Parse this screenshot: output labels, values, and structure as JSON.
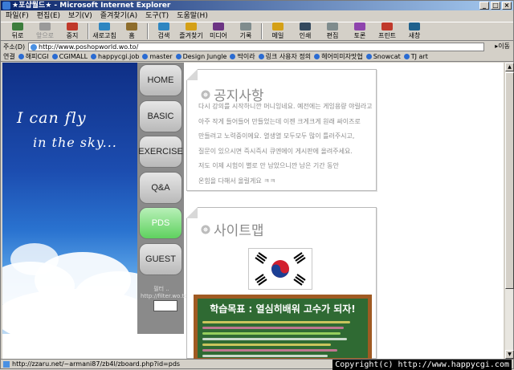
{
  "window": {
    "title": "★포샵월드★ - Microsoft Internet Explorer",
    "buttons": [
      "_",
      "□",
      "×"
    ]
  },
  "menubar": [
    "파일(F)",
    "편집(E)",
    "보기(V)",
    "즐겨찾기(A)",
    "도구(T)",
    "도움말(H)"
  ],
  "toolbar": [
    {
      "label": "뒤로",
      "icon": "back-arrow-icon",
      "disabled": false
    },
    {
      "label": "앞으로",
      "icon": "forward-arrow-icon",
      "disabled": true
    },
    {
      "label": "중지",
      "icon": "stop-icon",
      "disabled": false
    },
    {
      "label": "새로고침",
      "icon": "refresh-icon",
      "disabled": false
    },
    {
      "label": "홈",
      "icon": "home-icon",
      "disabled": false
    },
    {
      "label": "검색",
      "icon": "search-icon",
      "disabled": false
    },
    {
      "label": "즐겨찾기",
      "icon": "favorites-icon",
      "disabled": false
    },
    {
      "label": "미디어",
      "icon": "media-icon",
      "disabled": false
    },
    {
      "label": "기록",
      "icon": "history-icon",
      "disabled": false
    },
    {
      "label": "메일",
      "icon": "mail-icon",
      "disabled": false
    },
    {
      "label": "인쇄",
      "icon": "print-icon",
      "disabled": false
    },
    {
      "label": "편집",
      "icon": "edit-icon",
      "disabled": false
    },
    {
      "label": "토론",
      "icon": "discuss-icon",
      "disabled": false
    },
    {
      "label": "프린트",
      "icon": "printer-icon",
      "disabled": false
    },
    {
      "label": "새창",
      "icon": "new-window-icon",
      "disabled": false
    }
  ],
  "address": {
    "label": "주소(D)",
    "value": "http://www.poshopworld.wo.to/",
    "go": "이동"
  },
  "links": {
    "label": "연결",
    "items": [
      "해피CGI",
      "CGIMALL",
      "happycgi.job",
      "master",
      "Design Jungle",
      "딱이라",
      "링크 사용자 정의",
      "헤어미미자맛협",
      "Snowcat",
      "TJ art"
    ]
  },
  "hero": {
    "line1": "I can fly",
    "line2": "in the sky..."
  },
  "nav": [
    "HOME",
    "BASIC",
    "EXERCISE",
    "Q&A",
    "PDS",
    "GUEST"
  ],
  "nav_active": "PDS",
  "sidebar_text": [
    "필터 ..",
    "http://filter.wo.to"
  ],
  "notice": {
    "title": "공지사항",
    "lines": [
      "다시 강의를 시작하니깐 머니잉네요. 예전에는 게잉용량 야릴라고",
      "아주 작게 들어들어 만들었는데 이젠 크게크게 원래 싸이즈로",
      "만들려고 노력중이에요. 열생열 모두모두 많이 틀러주시고,",
      "질문이 있으시면 즉시즉시 큐엔에이 게시판에 올려주세요.",
      "저도 이제 시험이 별로 안 남았으니깐 남은 기간 동안",
      "온힘을 다해서 올릴게요 ㅋㅋ"
    ]
  },
  "sitemap": {
    "title": "사이트맵"
  },
  "board": {
    "title": "학습목표 : 열심히배워 고수가 되자!",
    "rows": [
      {
        "color": "#ffe46b",
        "len": 0.92
      },
      {
        "color": "#f07bb0",
        "len": 0.88
      },
      {
        "color": "#b8f06b",
        "len": 0.86
      },
      {
        "color": "#ffffff",
        "len": 0.9
      },
      {
        "color": "#ffe46b",
        "len": 0.8
      },
      {
        "color": "#f07bb0",
        "len": 0.84
      },
      {
        "color": "#ffffff",
        "len": 0.78
      }
    ]
  },
  "status": {
    "text": "http://zzaru.net/~armani87/zb4l/zboard.php?id=pds",
    "copyright": "Copyright(c) http://www.happycgi.com"
  }
}
